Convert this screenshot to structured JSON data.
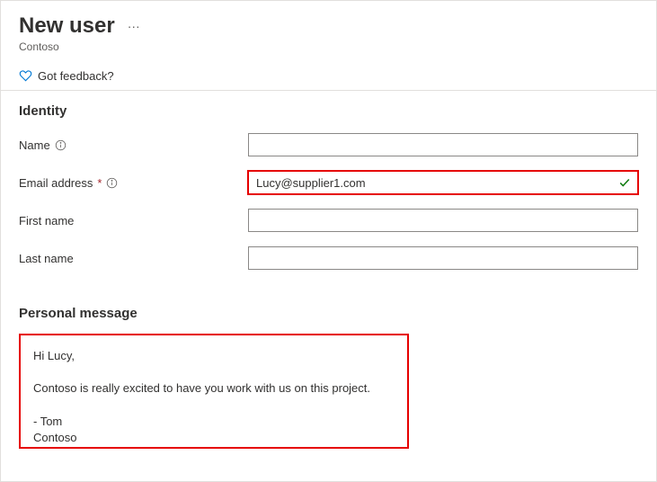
{
  "header": {
    "title": "New user",
    "subtitle": "Contoso"
  },
  "feedback": {
    "label": "Got feedback?"
  },
  "sections": {
    "identity_title": "Identity",
    "personal_title": "Personal message"
  },
  "fields": {
    "name": {
      "label": "Name",
      "value": ""
    },
    "email": {
      "label": "Email address",
      "value": "Lucy@supplier1.com"
    },
    "first_name": {
      "label": "First name",
      "value": ""
    },
    "last_name": {
      "label": "Last name",
      "value": ""
    }
  },
  "personal_message": {
    "value": "Hi Lucy,\n\nContoso is really excited to have you work with us on this project.\n\n- Tom\nContoso"
  }
}
